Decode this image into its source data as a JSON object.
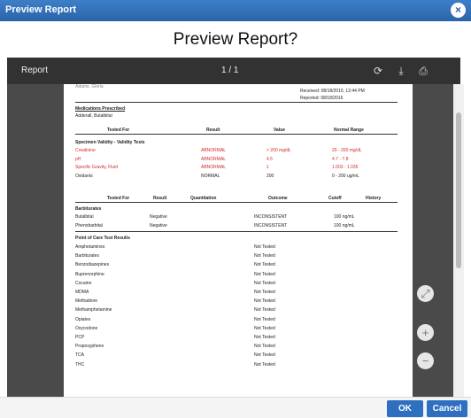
{
  "window": {
    "title": "Preview Report",
    "close_glyph": "×"
  },
  "heading": "Preview Report?",
  "viewer": {
    "name": "Report",
    "page": "1 / 1",
    "icons": [
      "rotate-icon",
      "download-icon",
      "print-icon"
    ]
  },
  "report": {
    "patient_cut": "Adams, Gloria",
    "received": "Received: 08/18/2016, 12:44 PM",
    "reported": "Reported: 08/18/2016",
    "meds_title": "Medications Prescribed",
    "meds": "Adderall, Butalbital",
    "validity_headers": [
      "Tested For",
      "Result",
      "Value",
      "Normal Range"
    ],
    "validity_section": "Specimen Validity - Validity Tests",
    "validity_rows": [
      [
        "Creatinine",
        "ABNORMAL",
        "> 200 mg/dL",
        "20 - 200 mg/dL"
      ],
      [
        "pH",
        "ABNORMAL",
        "4.5",
        "4.7 - 7.8"
      ],
      [
        "Specific Gravity, Fluid",
        "ABNORMAL",
        "1",
        "1.003 - 1.035"
      ],
      [
        "Oxidants",
        "NORMAL",
        "200",
        "0 - 200 ug/mL"
      ]
    ],
    "conf_headers": [
      "Tested For",
      "Result",
      "Quantitation",
      "Outcome",
      "Cutoff",
      "History"
    ],
    "barb_title": "Barbiturates",
    "conf_rows": [
      [
        "Butalbital",
        "Negative",
        "INCONSISTENT",
        "100 ng/mL"
      ],
      [
        "Phenobarbital",
        "Negative",
        "INCONSISTENT",
        "100 ng/mL"
      ]
    ],
    "poc_title": "Point of Care Test Results",
    "poc_rows": [
      "Amphetamines",
      "Barbiturates",
      "Benzodiazepines",
      "Buprenorphine",
      "Cocaine",
      "MDMA",
      "Methadone",
      "Methamphetamine",
      "Opiates",
      "Oxycodone",
      "PCP",
      "Propoxyphene",
      "TCA",
      "THC"
    ],
    "not_tested": "Not Tested"
  },
  "controls": {
    "fit": "⤢",
    "zoom_in": "+",
    "zoom_out": "−"
  },
  "footer": {
    "ok": "OK",
    "cancel": "Cancel"
  },
  "colors": {
    "accent": "#2f6fbf",
    "abnormal": "#d12b2b"
  }
}
